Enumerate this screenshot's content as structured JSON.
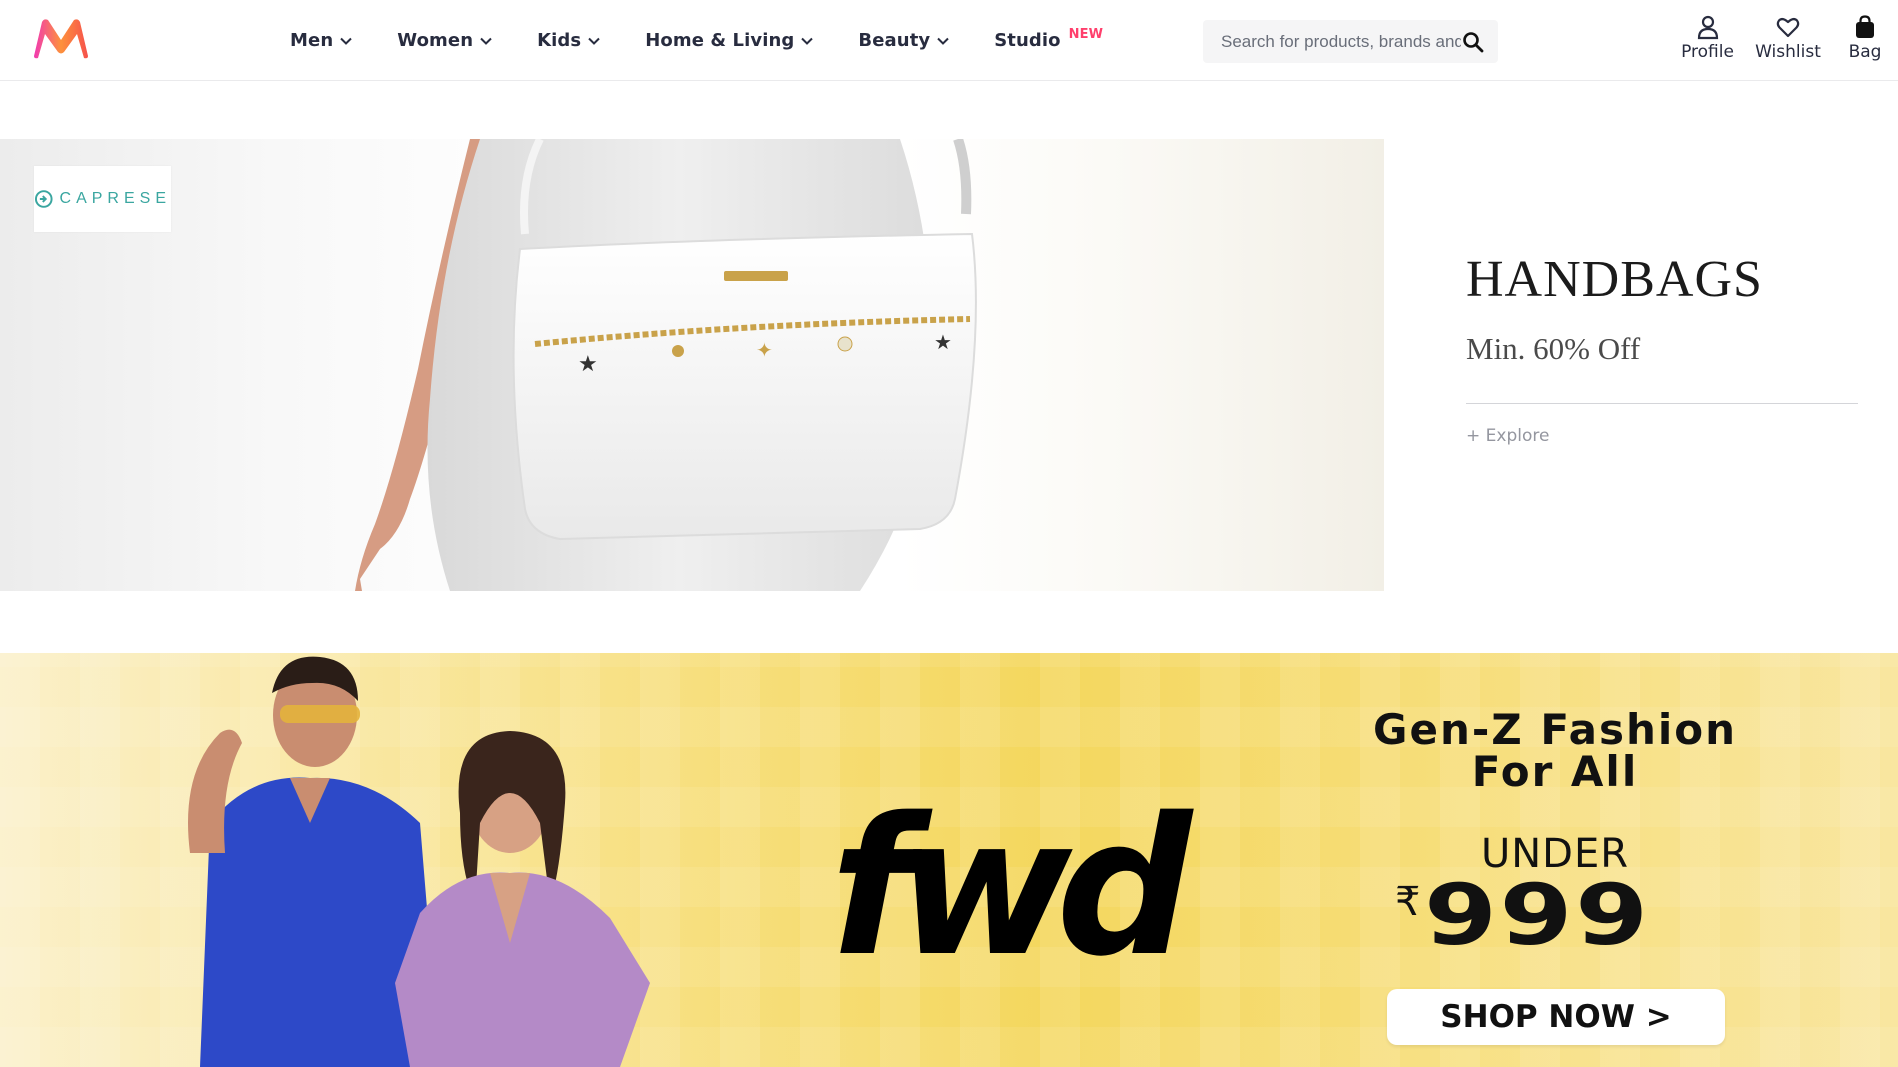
{
  "header": {
    "logo_icon": "myntra-logo-icon",
    "nav": [
      {
        "label": "Men"
      },
      {
        "label": "Women"
      },
      {
        "label": "Kids"
      },
      {
        "label": "Home & Living"
      },
      {
        "label": "Beauty"
      },
      {
        "label": "Studio",
        "badge": "NEW"
      }
    ],
    "search": {
      "placeholder": "Search for products, brands and more"
    },
    "actions": {
      "profile": "Profile",
      "wishlist": "Wishlist",
      "bag": "Bag"
    }
  },
  "handbags_banner": {
    "brand": "CAPRESE",
    "title": "HANDBAGS",
    "subtitle": "Min. 60% Off",
    "cta": "+ Explore"
  },
  "fwd_banner": {
    "logo": "fwd",
    "headline_line1": "Gen-Z Fashion",
    "headline_line2": "For All",
    "under": "UNDER",
    "currency": "₹",
    "price": "999",
    "cta": "SHOP NOW >"
  },
  "colors": {
    "brand_pink": "#ff3f6c",
    "text_primary": "#282c3f",
    "fwd_yellow": "#f4d75e",
    "caprese_teal": "#3aa6a0"
  }
}
